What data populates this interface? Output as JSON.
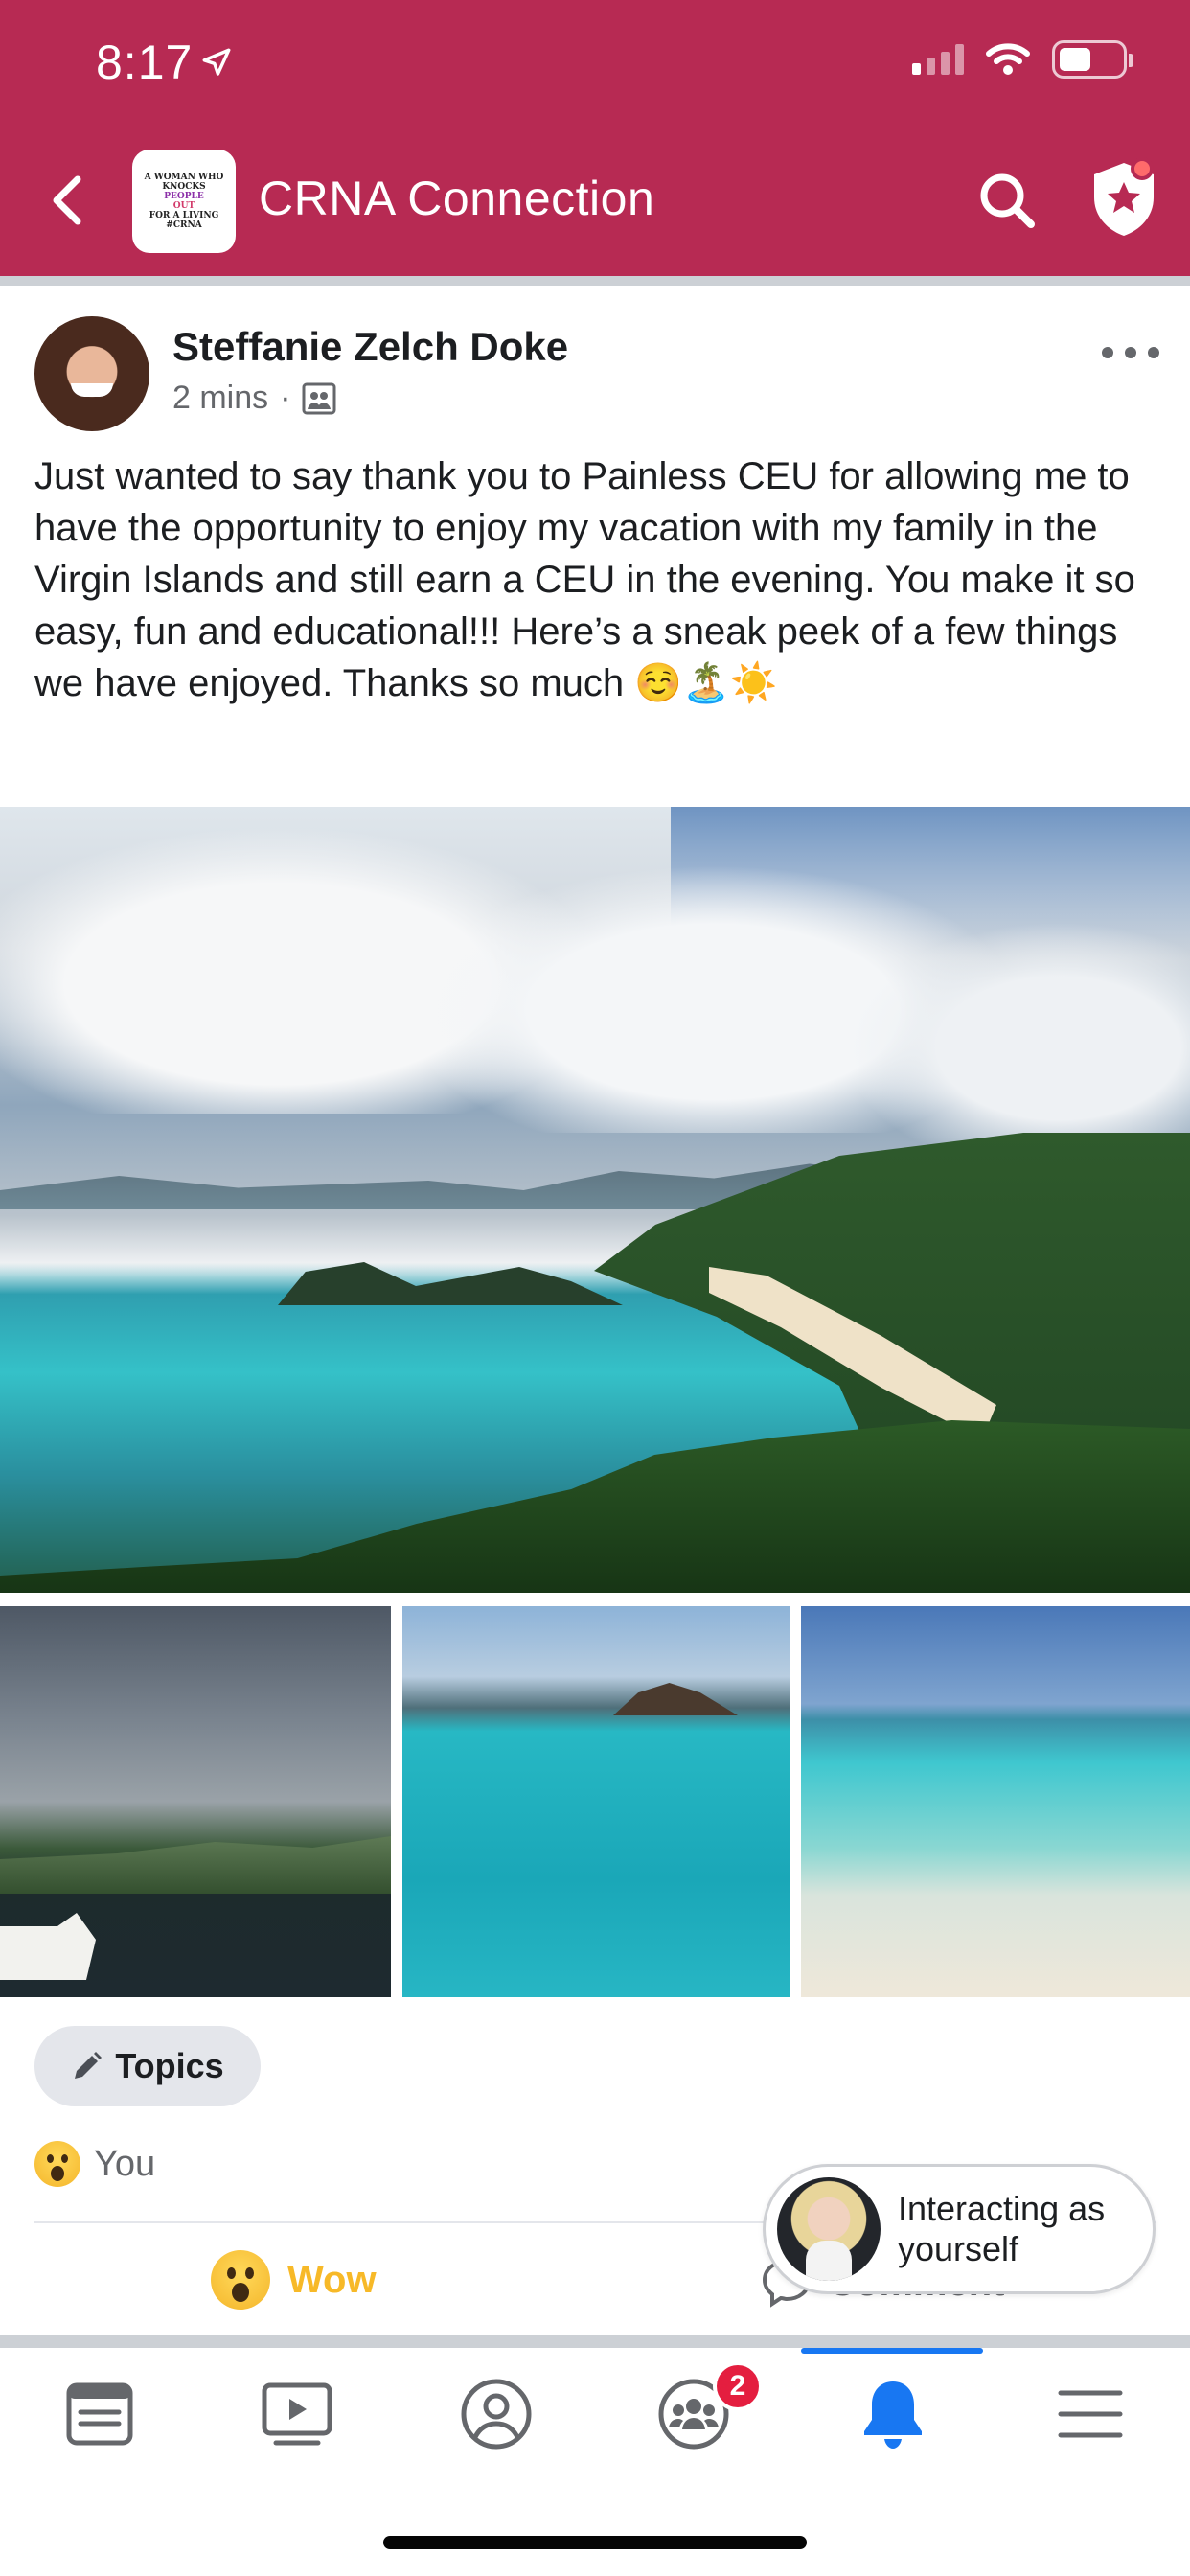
{
  "status_bar": {
    "time": "8:17"
  },
  "header": {
    "group_name": "CRNA Connection",
    "logo_lines": [
      "A WOMAN WHO",
      "KNOCKS",
      "PEOPLE",
      "OUT",
      "FOR A LIVING",
      "#CRNA"
    ]
  },
  "post": {
    "author": "Steffanie Zelch Doke",
    "timestamp": "2 mins",
    "text": "Just wanted to say thank you to Painless CEU for allowing me to have the opportunity to enjoy my vacation with my family in the Virgin Islands and still earn a CEU in the evening.  You make it so easy, fun and educational!!!  Here’s a sneak peek of a few things we have enjoyed.  Thanks so much ☺️🏝️☀️"
  },
  "topics_label": "Topics",
  "reactions": {
    "summary_name": "You"
  },
  "actions": {
    "wow_label": "Wow",
    "comment_label": "Comment"
  },
  "interacting": {
    "text": "Interacting as yourself"
  },
  "tab_bar": {
    "items": [
      "news-feed",
      "watch",
      "profile",
      "groups",
      "notifications",
      "menu"
    ],
    "groups_badge": "2",
    "active": "notifications",
    "accent": "#1877f2"
  },
  "colors": {
    "header_bg": "#b72a53",
    "wow": "#f7b928"
  }
}
